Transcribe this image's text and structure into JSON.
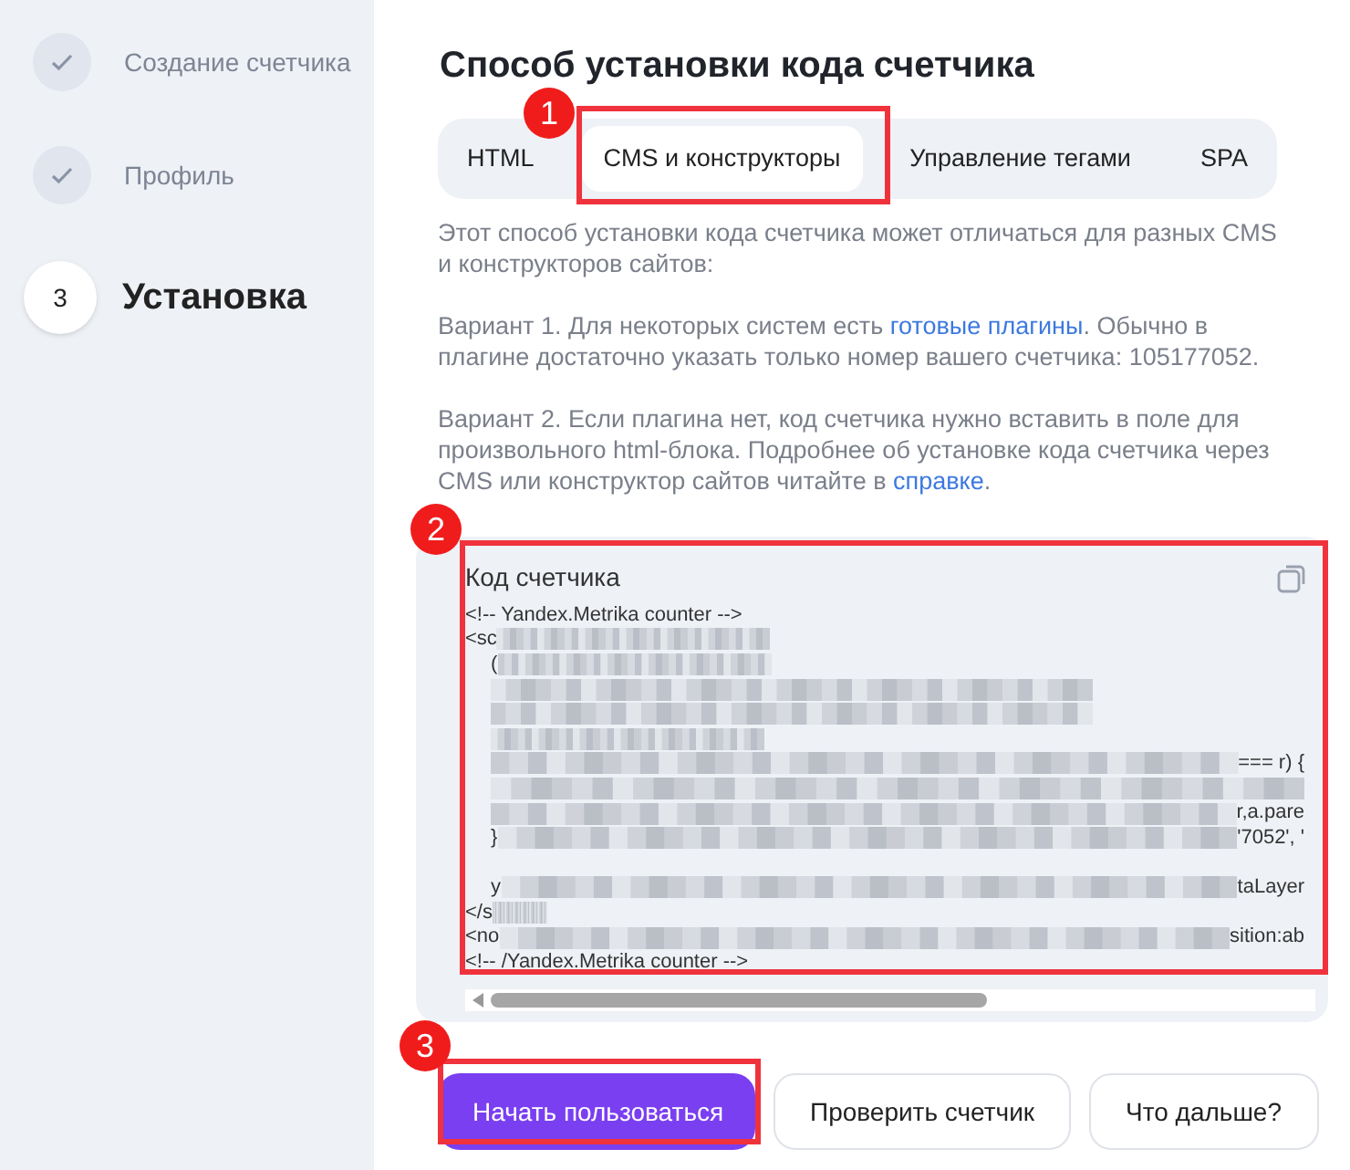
{
  "steps": [
    {
      "label": "Создание счетчика",
      "done": true,
      "selected": false
    },
    {
      "label": "Профиль",
      "done": true,
      "selected": false
    },
    {
      "number": "3",
      "label": "Установка",
      "done": false,
      "selected": true
    }
  ],
  "title": "Способ установки кода счетчика",
  "tabs": [
    {
      "label": "HTML",
      "selected": false
    },
    {
      "label": "CMS и конструкторы",
      "selected": true
    },
    {
      "label": "Управление тегами",
      "selected": false
    },
    {
      "label": "SPA",
      "selected": false
    }
  ],
  "paragraphs": [
    {
      "parts": [
        {
          "text": "Этот способ установки кода счетчика может отличаться для разных CMS и конструкторов сайтов:",
          "kind": "text"
        }
      ]
    },
    {
      "parts": [
        {
          "text": "Вариант 1. Для некоторых систем есть ",
          "kind": "text"
        },
        {
          "text": "готовые плагины",
          "kind": "link"
        },
        {
          "text": ". Обычно в плагине достаточно указать только номер вашего счетчика: 105177052.",
          "kind": "text"
        }
      ]
    },
    {
      "parts": [
        {
          "text": "Вариант 2. Если плагина нет, код счетчика нужно вставить в поле для произвольного html-блока. Подробнее об установке кода счетчика через CMS или конструктор сайтов читайте в ",
          "kind": "text"
        },
        {
          "text": "справке",
          "kind": "link"
        },
        {
          "text": ".",
          "kind": "text"
        }
      ]
    }
  ],
  "code": {
    "label": "Код счетчика",
    "lines": [
      {
        "start": "<!-- Yandex.Metrika counter -->",
        "kind": "plain"
      },
      {
        "start": "<sc",
        "kind": "short"
      },
      {
        "start": "(",
        "indent": true,
        "kind": "short"
      },
      {
        "indent": true,
        "kind": "mid"
      },
      {
        "indent": true,
        "kind": "mid"
      },
      {
        "indent": true,
        "kind": "short"
      },
      {
        "indent": true,
        "end": "=== r) {",
        "kind": "long"
      },
      {
        "indent": true,
        "kind": "long"
      },
      {
        "indent": true,
        "end": "r,a.pare",
        "kind": "long"
      },
      {
        "start": "}",
        "indent": true,
        "end": "'7052', '",
        "kind": "long"
      },
      {
        "kind": "gap"
      },
      {
        "start": "y",
        "indent": true,
        "end": "taLayer",
        "kind": "long"
      },
      {
        "start": "</s",
        "kind": "tiny"
      },
      {
        "start": "<no",
        "end": "sition:ab",
        "kind": "long"
      },
      {
        "start": "<!-- /Yandex.Metrika counter -->",
        "kind": "plain"
      }
    ]
  },
  "buttons": [
    {
      "label": "Начать пользоваться",
      "kind": "primary"
    },
    {
      "label": "Проверить счетчик",
      "kind": "secondary"
    },
    {
      "label": "Что дальше?",
      "kind": "secondary"
    }
  ],
  "annotations": [
    {
      "label": "1"
    },
    {
      "label": "2"
    },
    {
      "label": "3"
    }
  ]
}
